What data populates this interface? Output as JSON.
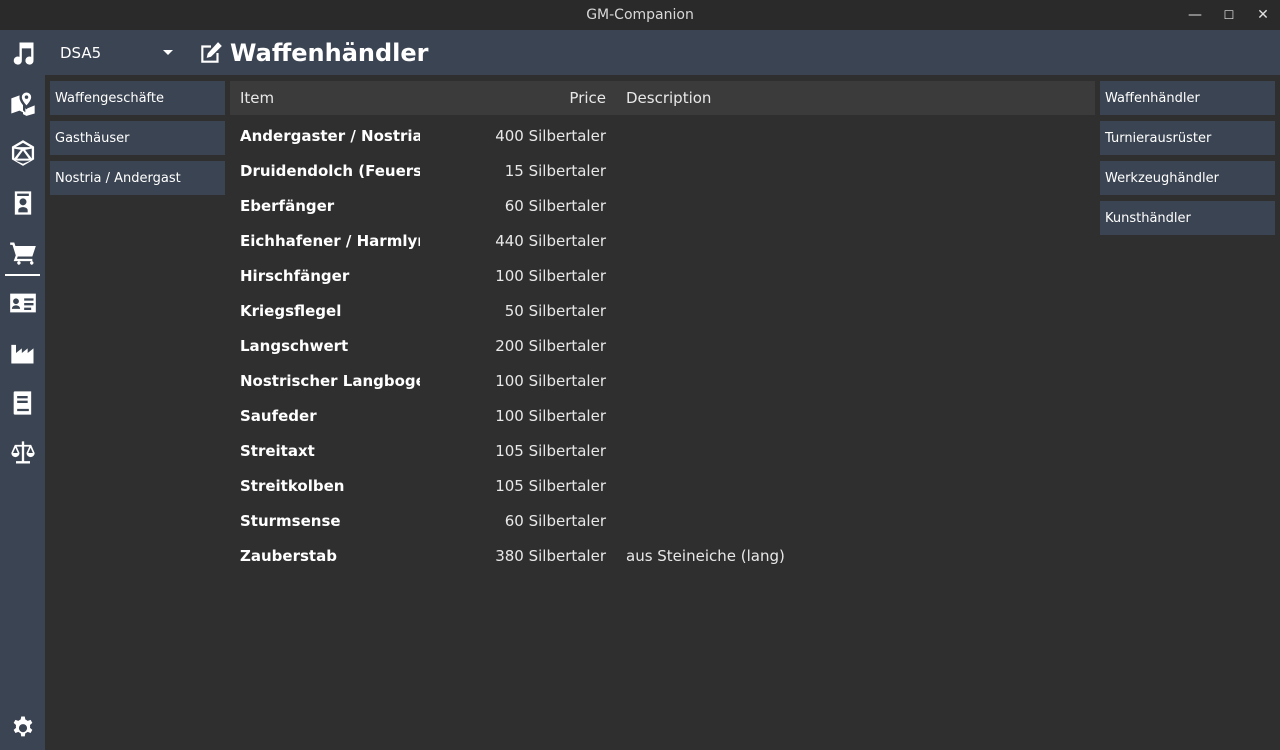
{
  "window": {
    "title": "GM-Companion",
    "minimize": "—",
    "maximize": "☐",
    "close": "✕"
  },
  "nav": [
    {
      "name": "music-icon"
    },
    {
      "name": "map-icon"
    },
    {
      "name": "dice-icon"
    },
    {
      "name": "character-icon"
    },
    {
      "name": "shop-icon",
      "active": true
    },
    {
      "name": "id-card-icon"
    },
    {
      "name": "factory-icon"
    },
    {
      "name": "book-icon"
    },
    {
      "name": "scales-icon"
    },
    {
      "name": "gear-icon"
    }
  ],
  "header": {
    "project": "DSA5",
    "title": "Waffenhändler"
  },
  "categories": [
    {
      "label": "Waffengeschäfte"
    },
    {
      "label": "Gasthäuser"
    },
    {
      "label": "Nostria / Andergast"
    }
  ],
  "shops": [
    {
      "label": "Waffenhändler"
    },
    {
      "label": "Turnierausrüster"
    },
    {
      "label": "Werkzeughändler"
    },
    {
      "label": "Kunsthändler"
    }
  ],
  "table": {
    "columns": {
      "item": "Item",
      "price": "Price",
      "description": "Description"
    },
    "rows": [
      {
        "item": "Andergaster / Nostria...",
        "price": "400 Silbertaler",
        "description": ""
      },
      {
        "item": "Druidendolch (Feuerst...",
        "price": "15 Silbertaler",
        "description": ""
      },
      {
        "item": "Eberfänger",
        "price": "60 Silbertaler",
        "description": ""
      },
      {
        "item": "Eichhafener / Harmlyn...",
        "price": "440 Silbertaler",
        "description": ""
      },
      {
        "item": "Hirschfänger",
        "price": "100 Silbertaler",
        "description": ""
      },
      {
        "item": "Kriegsflegel",
        "price": "50 Silbertaler",
        "description": ""
      },
      {
        "item": "Langschwert",
        "price": "200 Silbertaler",
        "description": ""
      },
      {
        "item": "Nostrischer Langbogen",
        "price": "100 Silbertaler",
        "description": ""
      },
      {
        "item": "Saufeder",
        "price": "100 Silbertaler",
        "description": ""
      },
      {
        "item": "Streitaxt",
        "price": "105 Silbertaler",
        "description": ""
      },
      {
        "item": "Streitkolben",
        "price": "105 Silbertaler",
        "description": ""
      },
      {
        "item": "Sturmsense",
        "price": "60 Silbertaler",
        "description": ""
      },
      {
        "item": "Zauberstab",
        "price": "380 Silbertaler",
        "description": "aus Steineiche (lang)"
      }
    ]
  }
}
